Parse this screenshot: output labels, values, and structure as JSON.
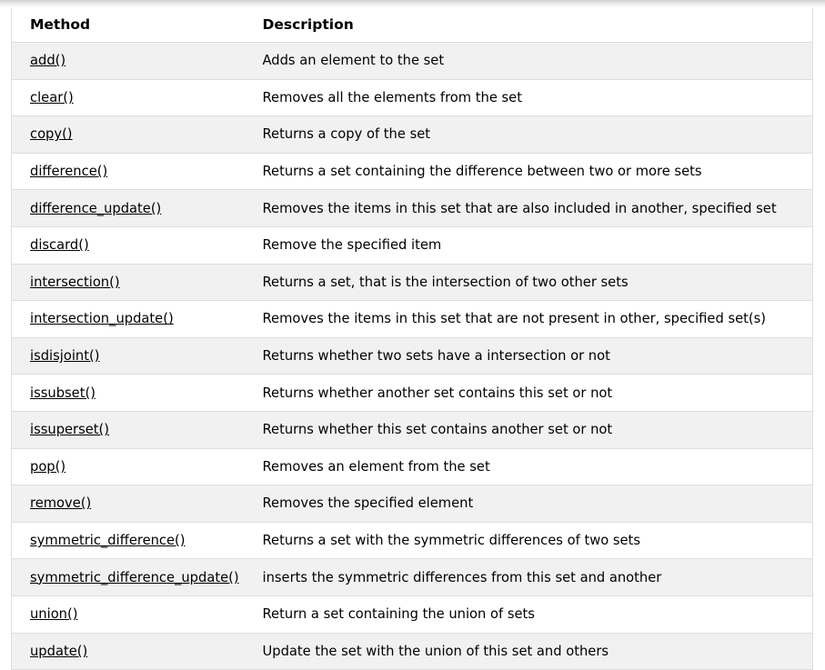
{
  "table": {
    "columns": [
      {
        "key": "method",
        "label": "Method"
      },
      {
        "key": "description",
        "label": "Description"
      }
    ],
    "rows": [
      {
        "method": "add()",
        "description": "Adds an element to the set"
      },
      {
        "method": "clear()",
        "description": "Removes all the elements from the set"
      },
      {
        "method": "copy()",
        "description": "Returns a copy of the set"
      },
      {
        "method": "difference()",
        "description": "Returns a set containing the difference between two or more sets"
      },
      {
        "method": "difference_update()",
        "description": "Removes the items in this set that are also included in another, specified set"
      },
      {
        "method": "discard()",
        "description": "Remove the specified item"
      },
      {
        "method": "intersection()",
        "description": "Returns a set, that is the intersection of two other sets"
      },
      {
        "method": "intersection_update()",
        "description": "Removes the items in this set that are not present in other, specified set(s)"
      },
      {
        "method": "isdisjoint()",
        "description": "Returns whether two sets have a intersection or not"
      },
      {
        "method": "issubset()",
        "description": "Returns whether another set contains this set or not"
      },
      {
        "method": "issuperset()",
        "description": "Returns whether this set contains another set or not"
      },
      {
        "method": "pop()",
        "description": "Removes an element from the set"
      },
      {
        "method": "remove()",
        "description": "Removes the specified element"
      },
      {
        "method": "symmetric_difference()",
        "description": "Returns a set with the symmetric differences of two sets"
      },
      {
        "method": "symmetric_difference_update()",
        "description": "inserts the symmetric differences from this set and another"
      },
      {
        "method": "union()",
        "description": "Return a set containing the union of sets"
      },
      {
        "method": "update()",
        "description": "Update the set with the union of this set and others"
      }
    ]
  },
  "style": {
    "row_stripe_color": "#f1f1f1",
    "row_base_color": "#ffffff",
    "border_color": "#dddddd",
    "text_color": "#000000",
    "link_color": "#000000"
  }
}
